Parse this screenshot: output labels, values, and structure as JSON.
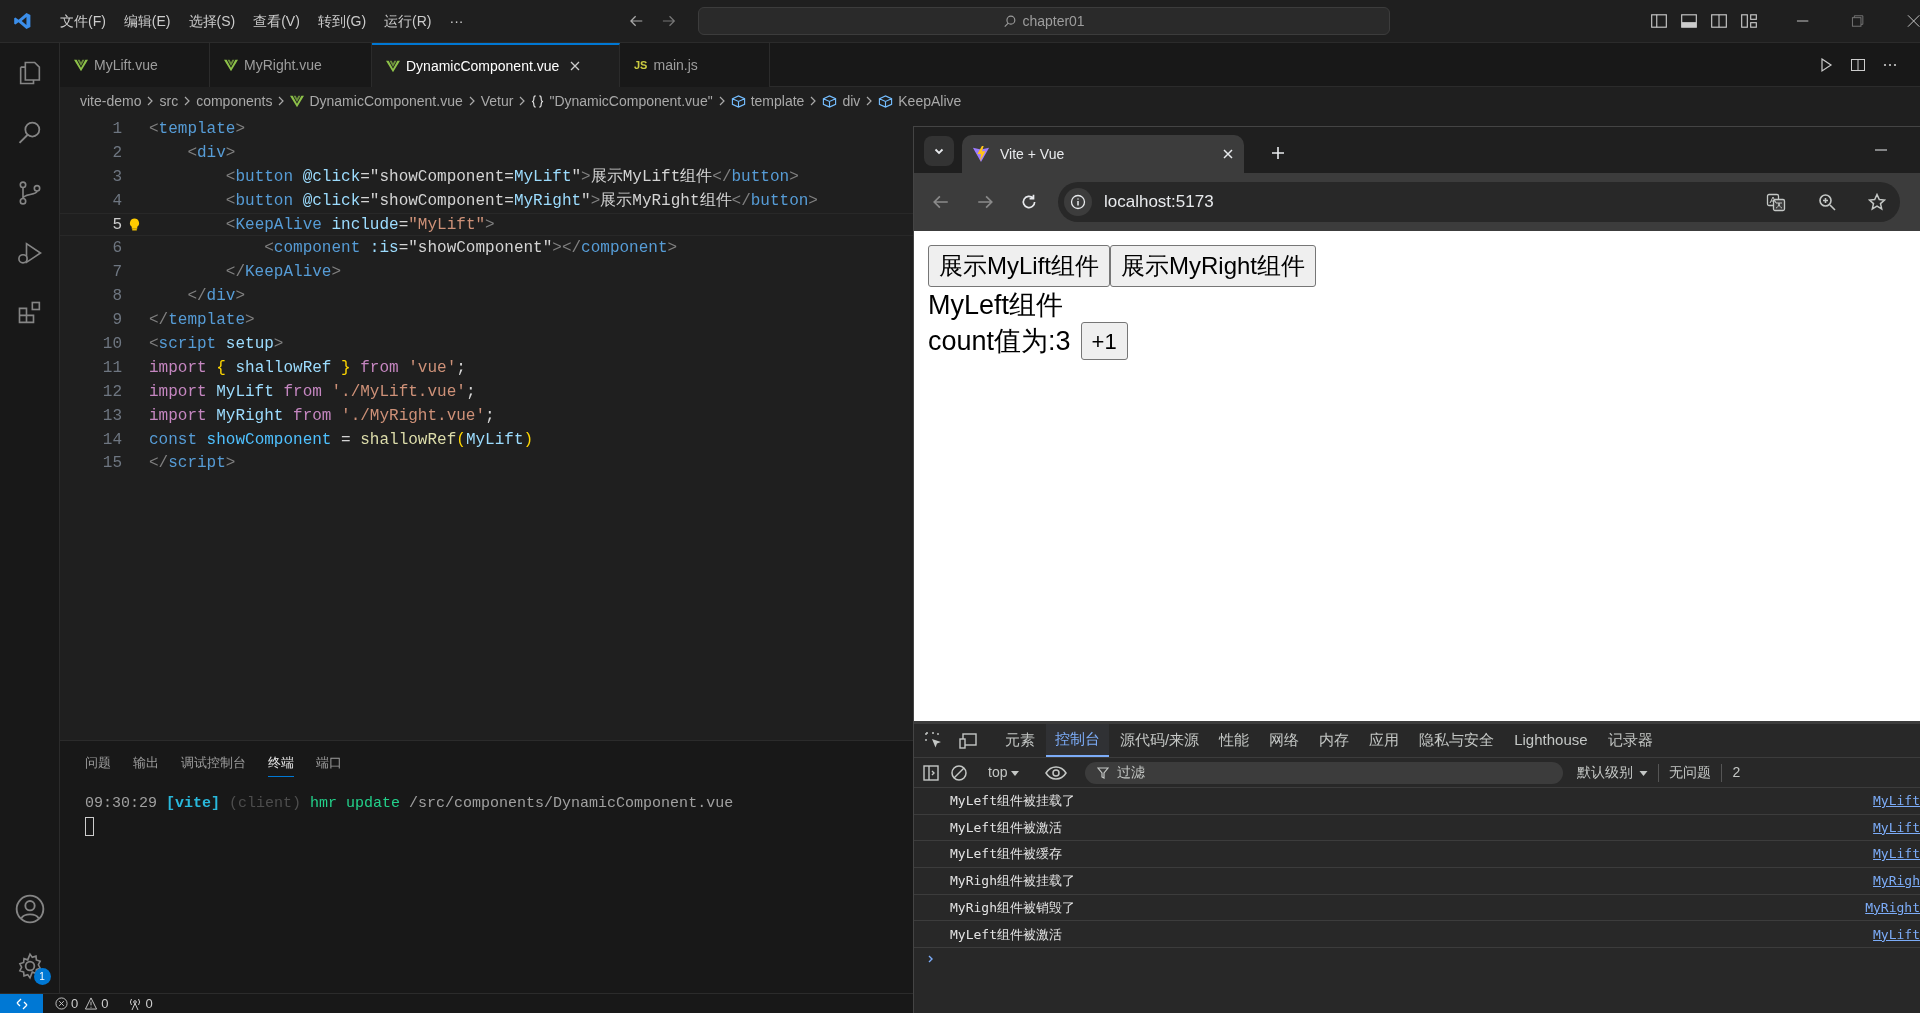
{
  "editor_window": {
    "menu": [
      "文件(F)",
      "编辑(E)",
      "选择(S)",
      "查看(V)",
      "转到(G)",
      "运行(R)",
      "···"
    ],
    "search": {
      "value": "chapter01"
    },
    "tabs": [
      {
        "label": "MyLift.vue",
        "kind": "vue",
        "selected": false
      },
      {
        "label": "MyRight.vue",
        "kind": "vue",
        "selected": false
      },
      {
        "label": "DynamicComponent.vue",
        "kind": "vue",
        "selected": true
      },
      {
        "label": "main.js",
        "kind": "js",
        "icon_text": "JS",
        "selected": false
      }
    ],
    "breadcrumb": [
      {
        "label": "vite-demo",
        "kind": "text"
      },
      {
        "label": "src",
        "kind": "text"
      },
      {
        "label": "components",
        "kind": "text"
      },
      {
        "label": "DynamicComponent.vue",
        "kind": "vue"
      },
      {
        "label": "Vetur",
        "kind": "text"
      },
      {
        "label": "\"DynamicComponent.vue\"",
        "kind": "braces"
      },
      {
        "label": "template",
        "kind": "element"
      },
      {
        "label": "div",
        "kind": "element"
      },
      {
        "label": "KeepAlive",
        "kind": "element"
      }
    ],
    "code_lines": [
      {
        "number": "1",
        "current": false,
        "lightbulb": false,
        "tokens": [
          {
            "text": "<",
            "kind": "p"
          },
          {
            "text": "template",
            "kind": "tag"
          },
          {
            "text": ">",
            "kind": "p"
          }
        ]
      },
      {
        "number": "2",
        "current": false,
        "lightbulb": false,
        "tokens": [
          {
            "text": "    <",
            "kind": "p"
          },
          {
            "text": "div",
            "kind": "tag"
          },
          {
            "text": ">",
            "kind": "p"
          }
        ]
      },
      {
        "number": "3",
        "current": false,
        "lightbulb": false,
        "tokens": [
          {
            "text": "        <",
            "kind": "p"
          },
          {
            "text": "button",
            "kind": "tag"
          },
          {
            "text": " @click",
            "kind": "attr"
          },
          {
            "text": "=\"showComponent=",
            "kind": "txt"
          },
          {
            "text": "MyLift",
            "kind": "id"
          },
          {
            "text": "\"",
            "kind": "txt"
          },
          {
            "text": ">",
            "kind": "p"
          },
          {
            "text": "展示MyLift组件",
            "kind": "txt"
          },
          {
            "text": "</",
            "kind": "p"
          },
          {
            "text": "button",
            "kind": "tag"
          },
          {
            "text": ">",
            "kind": "p"
          }
        ]
      },
      {
        "number": "4",
        "current": false,
        "lightbulb": false,
        "tokens": [
          {
            "text": "        <",
            "kind": "p"
          },
          {
            "text": "button",
            "kind": "tag"
          },
          {
            "text": " @click",
            "kind": "attr"
          },
          {
            "text": "=\"showComponent=",
            "kind": "txt"
          },
          {
            "text": "MyRight",
            "kind": "id"
          },
          {
            "text": "\"",
            "kind": "txt"
          },
          {
            "text": ">",
            "kind": "p"
          },
          {
            "text": "展示MyRight组件",
            "kind": "txt"
          },
          {
            "text": "</",
            "kind": "p"
          },
          {
            "text": "button",
            "kind": "tag"
          },
          {
            "text": ">",
            "kind": "p"
          }
        ]
      },
      {
        "number": "5",
        "current": true,
        "lightbulb": true,
        "tokens": [
          {
            "text": "        <",
            "kind": "p"
          },
          {
            "text": "KeepAlive",
            "kind": "tag"
          },
          {
            "text": " include",
            "kind": "attr"
          },
          {
            "text": "=",
            "kind": "txt"
          },
          {
            "text": "\"MyLift\"",
            "kind": "str"
          },
          {
            "text": ">",
            "kind": "p"
          }
        ]
      },
      {
        "number": "6",
        "current": false,
        "lightbulb": false,
        "tokens": [
          {
            "text": "            <",
            "kind": "p"
          },
          {
            "text": "component",
            "kind": "tag"
          },
          {
            "text": " :is",
            "kind": "attr"
          },
          {
            "text": "=\"showComponent\"",
            "kind": "txt"
          },
          {
            "text": "></",
            "kind": "p"
          },
          {
            "text": "component",
            "kind": "tag"
          },
          {
            "text": ">",
            "kind": "p"
          }
        ]
      },
      {
        "number": "7",
        "current": false,
        "lightbulb": false,
        "tokens": [
          {
            "text": "        </",
            "kind": "p"
          },
          {
            "text": "KeepAlive",
            "kind": "tag"
          },
          {
            "text": ">",
            "kind": "p"
          }
        ]
      },
      {
        "number": "8",
        "current": false,
        "lightbulb": false,
        "tokens": [
          {
            "text": "    </",
            "kind": "p"
          },
          {
            "text": "div",
            "kind": "tag"
          },
          {
            "text": ">",
            "kind": "p"
          }
        ]
      },
      {
        "number": "9",
        "current": false,
        "lightbulb": false,
        "tokens": [
          {
            "text": "</",
            "kind": "p"
          },
          {
            "text": "template",
            "kind": "tag"
          },
          {
            "text": ">",
            "kind": "p"
          }
        ]
      },
      {
        "number": "10",
        "current": false,
        "lightbulb": false,
        "tokens": [
          {
            "text": "<",
            "kind": "p"
          },
          {
            "text": "script",
            "kind": "tag"
          },
          {
            "text": " setup",
            "kind": "attr"
          },
          {
            "text": ">",
            "kind": "p"
          }
        ]
      },
      {
        "number": "11",
        "current": false,
        "lightbulb": false,
        "tokens": [
          {
            "text": "import ",
            "kind": "kw"
          },
          {
            "text": "{",
            "kind": "br"
          },
          {
            "text": " shallowRef ",
            "kind": "id"
          },
          {
            "text": "}",
            "kind": "br"
          },
          {
            "text": " from ",
            "kind": "kw"
          },
          {
            "text": "'vue'",
            "kind": "str"
          },
          {
            "text": ";",
            "kind": "txt"
          }
        ]
      },
      {
        "number": "12",
        "current": false,
        "lightbulb": false,
        "tokens": [
          {
            "text": "import",
            "kind": "kw"
          },
          {
            "text": " MyLift",
            "kind": "id"
          },
          {
            "text": " from",
            "kind": "kw"
          },
          {
            "text": " './MyLift.vue'",
            "kind": "str"
          },
          {
            "text": ";",
            "kind": "txt"
          }
        ]
      },
      {
        "number": "13",
        "current": false,
        "lightbulb": false,
        "tokens": [
          {
            "text": "import",
            "kind": "kw"
          },
          {
            "text": " MyRight",
            "kind": "id"
          },
          {
            "text": " from",
            "kind": "kw"
          },
          {
            "text": " './MyRight.vue'",
            "kind": "str"
          },
          {
            "text": ";",
            "kind": "txt"
          }
        ]
      },
      {
        "number": "14",
        "current": false,
        "lightbulb": false,
        "tokens": [
          {
            "text": "const",
            "kind": "tag"
          },
          {
            "text": " showComponent",
            "kind": "cst"
          },
          {
            "text": " = ",
            "kind": "txt"
          },
          {
            "text": "shallowRef",
            "kind": "fn"
          },
          {
            "text": "(",
            "kind": "br"
          },
          {
            "text": "MyLift",
            "kind": "id"
          },
          {
            "text": ")",
            "kind": "br"
          }
        ]
      },
      {
        "number": "15",
        "current": false,
        "lightbulb": false,
        "tokens": [
          {
            "text": "</",
            "kind": "p"
          },
          {
            "text": "script",
            "kind": "tag"
          },
          {
            "text": ">",
            "kind": "p"
          }
        ]
      }
    ],
    "panel_tabs": [
      {
        "label": "问题",
        "selected": false
      },
      {
        "label": "输出",
        "selected": false
      },
      {
        "label": "调试控制台",
        "selected": false
      },
      {
        "label": "终端",
        "selected": true
      },
      {
        "label": "端口",
        "selected": false
      }
    ],
    "terminal_line": [
      {
        "text": "09:30:29 ",
        "kind": "time"
      },
      {
        "text": "[vite]",
        "kind": "vite"
      },
      {
        "text": " (client)",
        "kind": "dim"
      },
      {
        "text": " hmr update",
        "kind": "ok"
      },
      {
        "text": " /src/components/DynamicComponent.vue",
        "kind": "path"
      }
    ],
    "settings_badge": "1",
    "status_bar": {
      "errors": "0",
      "warnings": "0",
      "ports": "0"
    }
  },
  "browser_window": {
    "tab": {
      "title": "Vite + Vue"
    },
    "address": "localhost:5173",
    "page": {
      "buttons": [
        "展示MyLift组件",
        "展示MyRight组件"
      ],
      "heading": "MyLeft组件",
      "count_text": "count值为:3",
      "increment_button": "+1"
    },
    "devtools": {
      "tabs": [
        {
          "label": "元素",
          "selected": false
        },
        {
          "label": "控制台",
          "selected": true
        },
        {
          "label": "源代码/来源",
          "selected": false
        },
        {
          "label": "性能",
          "selected": false
        },
        {
          "label": "网络",
          "selected": false
        },
        {
          "label": "内存",
          "selected": false
        },
        {
          "label": "应用",
          "selected": false
        },
        {
          "label": "隐私与安全",
          "selected": false
        },
        {
          "label": "Lighthouse",
          "selected": false
        },
        {
          "label": "记录器",
          "selected": false
        }
      ],
      "context": "top",
      "filter_placeholder": "过滤",
      "level": "默认级别",
      "issues": "无问题",
      "count": "2",
      "messages": [
        {
          "text": "MyLeft组件被挂载了",
          "source": "MyLift"
        },
        {
          "text": "MyLeft组件被激活",
          "source": "MyLift"
        },
        {
          "text": "MyLeft组件被缓存",
          "source": "MyLift"
        },
        {
          "text": "MyRigh组件被挂载了",
          "source": "MyRigh"
        },
        {
          "text": "MyRigh组件被销毁了",
          "source": "MyRight"
        },
        {
          "text": "MyLeft组件被激活",
          "source": "MyLift"
        }
      ]
    }
  }
}
